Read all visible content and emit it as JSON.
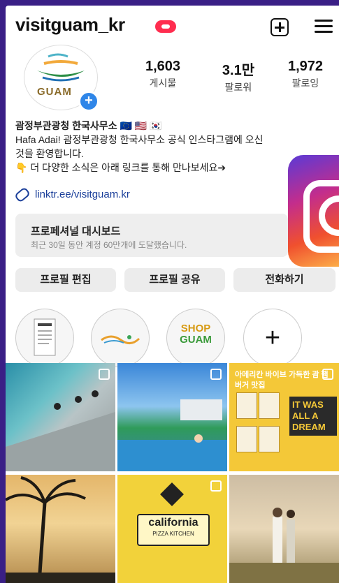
{
  "profile": {
    "username": "visitguam_kr",
    "avatar_logo_text": "GUAM",
    "stats": [
      {
        "value": "1,603",
        "label": "게시물"
      },
      {
        "value": "3.1만",
        "label": "팔로워"
      },
      {
        "value": "1,972",
        "label": "팔로잉"
      }
    ],
    "bio_name": "괌정부관광청 한국사무소 🇪🇺 🇺🇸 🇰🇷",
    "bio_line1": "Hafa Adai! 괌정부관광청 한국사무소 공식 인스타그램에 오신",
    "bio_line2": "것을 환영합니다.",
    "bio_line3": "👇 더 다양한 소식은 아래 링크를 통해 만나보세요➔",
    "link": "linktr.ee/visitguam.kr"
  },
  "dashboard": {
    "title": "프로페셔널 대시보드",
    "subtitle": "최근 30일 동안 계정 60만개에 도달했습니다."
  },
  "buttons": {
    "edit": "프로필 편집",
    "share": "프로필 공유",
    "call": "전화하기"
  },
  "highlights": {
    "shop_line1": "SHOP",
    "shop_line2": "GUAM",
    "add_symbol": "+"
  },
  "posts": {
    "post3_caption": "아메리칸 바이브 가득한 괌 햄버거 맛집",
    "post3_sign": "IT WAS ALL A DREAM",
    "post5_sign_main": "california",
    "post5_sign_sub": "PIZZA KITCHEN"
  },
  "colors": {
    "frame": "#3a1f86",
    "link": "#1b3f9a",
    "live_badge": "#ff2d4f",
    "add_avatar": "#2f86e8"
  },
  "icons": [
    "live-badge-icon",
    "new-post-icon",
    "menu-icon",
    "link-icon",
    "instagram-logo-icon"
  ]
}
